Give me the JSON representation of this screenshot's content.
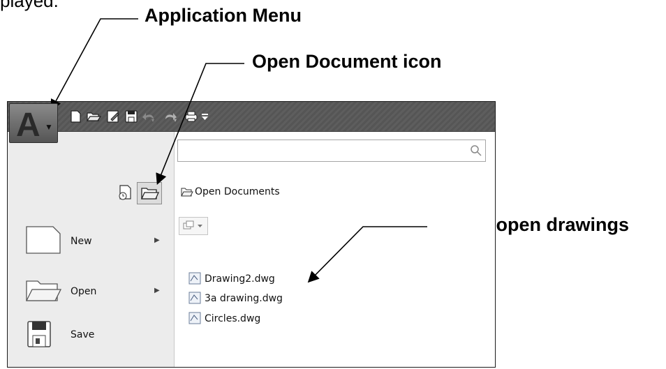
{
  "fragment": "played.",
  "callouts": {
    "application_menu": "Application Menu",
    "open_document_icon": "Open Document icon",
    "list_of_open_drawings": "List of open drawings"
  },
  "search": {
    "placeholder": ""
  },
  "left_menu": {
    "items": [
      {
        "label": "New"
      },
      {
        "label": "Open"
      },
      {
        "label": "Save"
      }
    ]
  },
  "panel": {
    "title": "Open Documents",
    "files": [
      {
        "name": "Drawing2.dwg"
      },
      {
        "name": "3a drawing.dwg"
      },
      {
        "name": "Circles.dwg"
      }
    ]
  },
  "icons": {
    "app_button": "autocad-a-icon",
    "quick_access": [
      "new-icon",
      "open-icon",
      "saveas-icon",
      "save-icon",
      "undo-icon",
      "redo-icon",
      "plot-icon",
      "customize-dropdown-icon"
    ],
    "recent_documents": "recent-documents-icon",
    "open_documents": "open-documents-icon"
  },
  "colors": {
    "titlebar": "#585858",
    "pane_bg": "#ececec",
    "panel_bg": "#ffffff"
  }
}
